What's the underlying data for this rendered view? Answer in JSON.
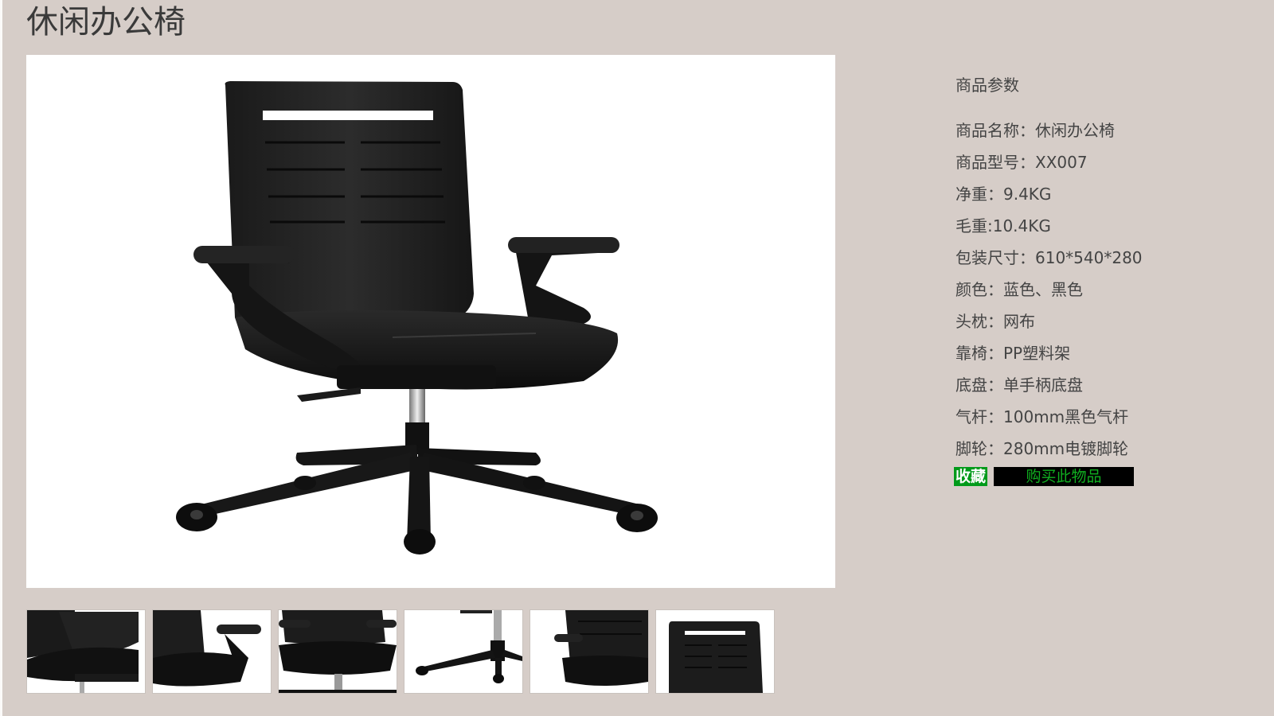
{
  "page": {
    "title": "休闲办公椅"
  },
  "gallery": {
    "main_image": "office-chair-photo",
    "thumbnails": [
      {
        "image": "chair-armrest-closeup"
      },
      {
        "image": "chair-seat-side"
      },
      {
        "image": "chair-armrest-front"
      },
      {
        "image": "chair-base-caster"
      },
      {
        "image": "chair-back-side"
      },
      {
        "image": "chair-backrest-front"
      }
    ]
  },
  "params": {
    "title": "商品参数",
    "items": [
      "商品名称：休闲办公椅",
      "商品型号：XX007",
      "净重：9.4KG",
      "毛重:10.4KG",
      "包装尺寸：610*540*280",
      "颜色：蓝色、黑色",
      "头枕：网布",
      "靠椅：PP塑料架",
      "底盘：单手柄底盘",
      "气杆：100mm黑色气杆",
      "脚轮：280mm电镀脚轮"
    ]
  },
  "actions": {
    "favorite_label": "收藏",
    "buy_label": "购买此物品"
  },
  "colors": {
    "background": "#d6cdc8",
    "favorite_bg": "#009a1a",
    "buy_bg": "#000000",
    "buy_text": "#10b020"
  }
}
